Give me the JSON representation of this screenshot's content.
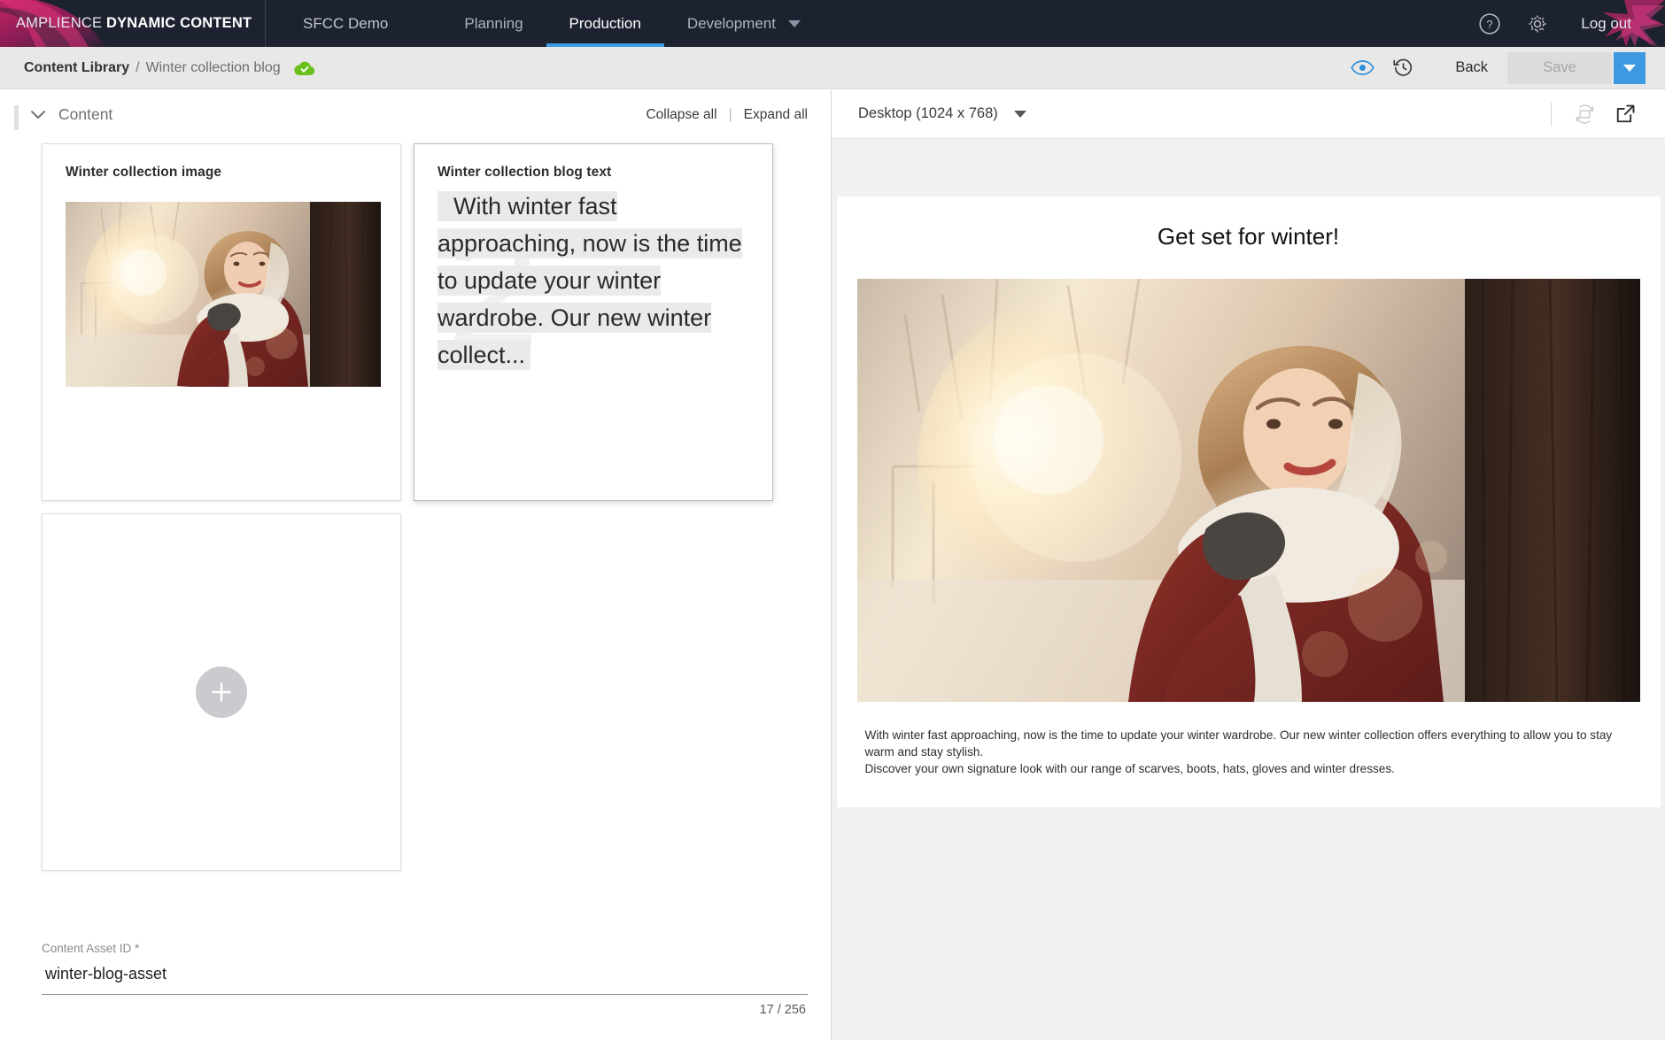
{
  "topnav": {
    "logo_thin": "AMPLIENCE ",
    "logo_bold": "DYNAMIC CONTENT",
    "project": "SFCC Demo",
    "items": [
      {
        "label": "Planning",
        "active": false
      },
      {
        "label": "Production",
        "active": true
      },
      {
        "label": "Development",
        "active": false,
        "has_caret": true
      }
    ],
    "help_icon": "help-circle-icon",
    "settings_icon": "gear-icon",
    "logout": "Log out"
  },
  "crumbbar": {
    "root": "Content Library",
    "separator": "/",
    "leaf": "Winter collection blog",
    "status_icon": "cloud-published-icon",
    "preview_icon": "eye-icon",
    "history_icon": "history-clock-icon",
    "back": "Back",
    "save": "Save",
    "save_dropdown_icon": "chevron-down-icon"
  },
  "form": {
    "section_title": "Content",
    "collapse_icon": "chevron-down-icon",
    "collapse_all": "Collapse all",
    "link_divider": "|",
    "expand_all": "Expand all",
    "cards": [
      {
        "label": "Winter collection image",
        "type": "image",
        "selected": false
      },
      {
        "label": "Winter collection blog text",
        "type": "text",
        "watermark": "2",
        "excerpt": "With winter fast approaching, now is the time to update your winter wardrobe. Our new winter collect...",
        "selected": true
      }
    ],
    "add_card_icon": "plus-icon",
    "field": {
      "label": "Content Asset ID *",
      "value": "winter-blog-asset",
      "placeholder": "",
      "counter": "17 / 256"
    }
  },
  "preview": {
    "device": "Desktop (1024 x 768)",
    "device_caret_icon": "chevron-down-icon",
    "rotate_icon": "rotate-device-icon",
    "popout_icon": "open-in-new-window-icon",
    "doc": {
      "title": "Get set for winter!",
      "hero_alt": "winter-collection-hero-image",
      "paragraphs": [
        "With winter fast approaching, now is the time to update your winter wardrobe. Our new winter collection offers everything to allow you to stay warm and stay stylish.",
        "Discover your own signature look with our range of scarves, boots, hats, gloves and winter dresses."
      ]
    }
  },
  "colors": {
    "nav_bg": "#1d2230",
    "accent_blue": "#3d9ae2",
    "brand_magenta": "#b3215f",
    "published_green": "#68c11a",
    "crumb_bg": "#e8e8e8"
  }
}
